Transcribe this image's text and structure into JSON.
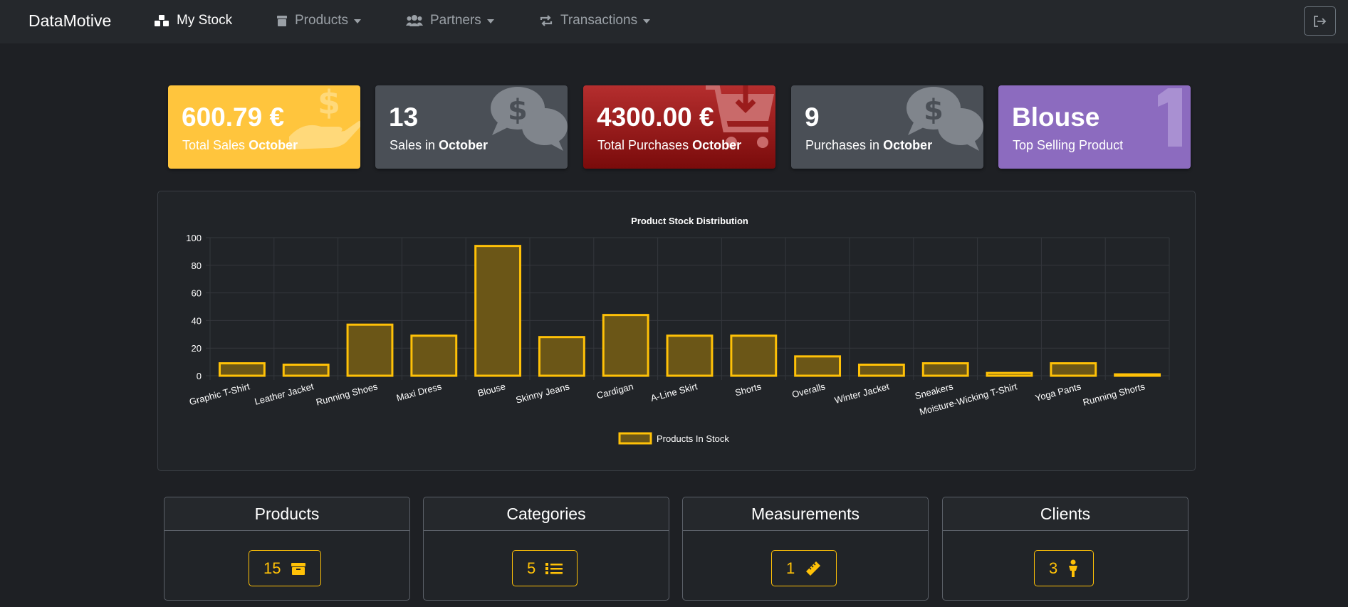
{
  "navbar": {
    "brand": "DataMotive",
    "items": [
      {
        "label": "My Stock",
        "icon": "boxes-icon",
        "active": true
      },
      {
        "label": "Products",
        "icon": "box-icon",
        "dropdown": true
      },
      {
        "label": "Partners",
        "icon": "users-icon",
        "dropdown": true
      },
      {
        "label": "Transactions",
        "icon": "exchange-icon",
        "dropdown": true
      }
    ],
    "logout_icon": "logout-icon"
  },
  "stats": [
    {
      "value": "600.79 €",
      "label_prefix": "Total Sales ",
      "label_bold": "October",
      "color": "#ffc53d",
      "icon": "hand-dollar-icon"
    },
    {
      "value": "13",
      "label_prefix": "Sales in ",
      "label_bold": "October",
      "color": "#4a4f56",
      "icon": "comments-dollar-icon"
    },
    {
      "value": "4300.00 €",
      "label_prefix": "Total Purchases ",
      "label_bold": "October",
      "color": "#9b1c1c",
      "icon": "cart-download-icon"
    },
    {
      "value": "9",
      "label_prefix": "Purchases in ",
      "label_bold": "October",
      "color": "#4a4f56",
      "icon": "comments-dollar-icon"
    },
    {
      "value": "Blouse",
      "label_prefix": "Top Selling Product",
      "label_bold": "",
      "color": "#8c6bbf",
      "icon": "number-one-icon"
    }
  ],
  "chart_data": {
    "type": "bar",
    "title": "Product Stock Distribution",
    "categories": [
      "Graphic T-Shirt",
      "Leather Jacket",
      "Running Shoes",
      "Maxi Dress",
      "Blouse",
      "Skinny Jeans",
      "Cardigan",
      "A-Line Skirt",
      "Shorts",
      "Overalls",
      "Winter Jacket",
      "Sneakers",
      "Moisture-Wicking T-Shirt",
      "Yoga Pants",
      "Running Shorts"
    ],
    "series": [
      {
        "name": "Products In Stock",
        "values": [
          9,
          8,
          37,
          29,
          94,
          28,
          44,
          29,
          29,
          14,
          8,
          9,
          2,
          9,
          1
        ],
        "fill": "#6b5617",
        "stroke": "#ffc107"
      }
    ],
    "ylim": [
      0,
      100
    ],
    "yticks": [
      0,
      20,
      40,
      60,
      80,
      100
    ],
    "legend_position": "bottom",
    "grid": true
  },
  "cards": [
    {
      "title": "Products",
      "count": "15",
      "icon": "box-icon"
    },
    {
      "title": "Categories",
      "count": "5",
      "icon": "list-icon"
    },
    {
      "title": "Measurements",
      "count": "1",
      "icon": "ruler-icon"
    },
    {
      "title": "Clients",
      "count": "3",
      "icon": "person-icon"
    }
  ]
}
